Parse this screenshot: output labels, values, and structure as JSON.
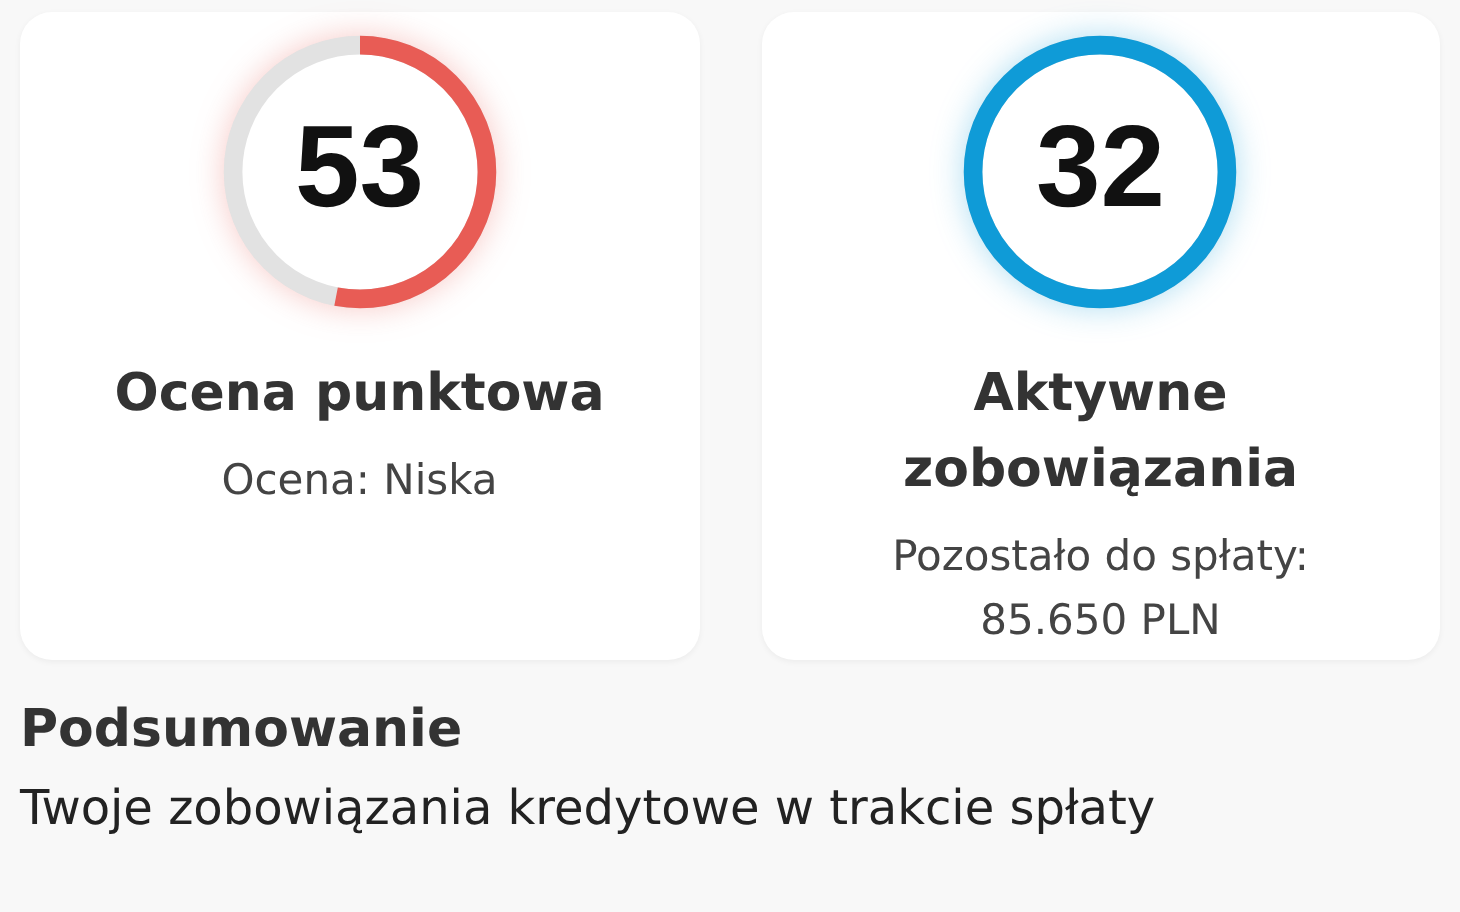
{
  "cards": [
    {
      "score": "53",
      "level": 0.53,
      "color": "#e85c55",
      "title": "Ocena punktowa",
      "subtitle": "Ocena: Niska"
    },
    {
      "score": "32",
      "color": "#0f9bd7",
      "title": "Aktywne zobowiązania",
      "subtitle": "Pozostało do spłaty: 85.650 PLN"
    }
  ],
  "summary": {
    "heading": "Podsumowanie",
    "text": "Twoje zobowiązania kredytowe w trakcie spłaty"
  }
}
